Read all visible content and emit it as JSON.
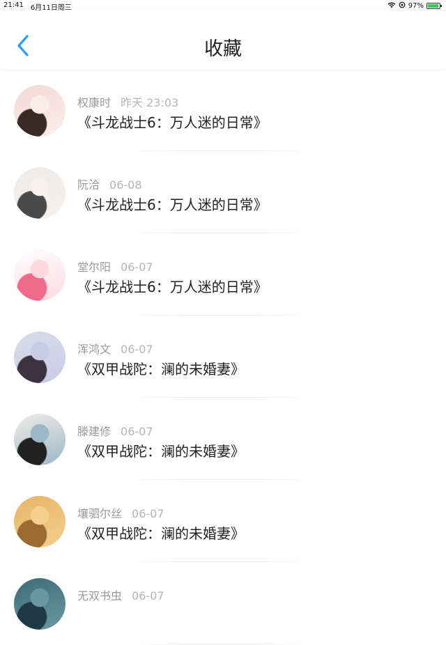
{
  "status_bar": {
    "time": "21:41",
    "date": "6月11日周三",
    "battery": "97%",
    "battery_level": 0.97
  },
  "header": {
    "title": "收藏"
  },
  "favorites": [
    {
      "user": "权康时",
      "time": "昨天 23:03",
      "book": "《斗龙战士6：万人迷的日常》",
      "avatar_colors": [
        "#f3d9d4",
        "#3a2a26",
        "#fbeee8"
      ]
    },
    {
      "user": "阮洽",
      "time": "06-08",
      "book": "《斗龙战士6：万人迷的日常》",
      "avatar_colors": [
        "#eceae8",
        "#4a4a4a",
        "#f6f1ee"
      ]
    },
    {
      "user": "堂尔阳",
      "time": "06-07",
      "book": "《斗龙战士6：万人迷的日常》",
      "avatar_colors": [
        "#ffffff",
        "#f06a8a",
        "#ffd9e2"
      ]
    },
    {
      "user": "浑鸿文",
      "time": "06-07",
      "book": "《双甲战陀：澜的未婚妻》",
      "avatar_colors": [
        "#d9dde8",
        "#3b3340",
        "#c9cbe6"
      ]
    },
    {
      "user": "滕建修",
      "time": "06-07",
      "book": "《双甲战陀：澜的未婚妻》",
      "avatar_colors": [
        "#f1ece6",
        "#222222",
        "#9bb8c9"
      ]
    },
    {
      "user": "壤驷尔丝",
      "time": "06-07",
      "book": "《双甲战陀：澜的未婚妻》",
      "avatar_colors": [
        "#e7b46a",
        "#9a6a32",
        "#f3d08c"
      ]
    },
    {
      "user": "无双书虫",
      "time": "06-07",
      "book": "",
      "avatar_colors": [
        "#3f6b78",
        "#1f3a44",
        "#6a99a4"
      ]
    }
  ]
}
